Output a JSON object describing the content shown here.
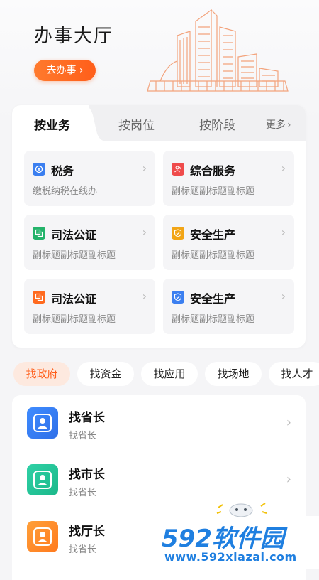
{
  "hero": {
    "title": "办事大厅",
    "button_label": "去办事 ›"
  },
  "tabs": {
    "items": [
      {
        "label": "按业务",
        "active": true
      },
      {
        "label": "按岗位",
        "active": false
      },
      {
        "label": "按阶段",
        "active": false
      }
    ],
    "more_label": "更多",
    "more_chevron": "›"
  },
  "services": [
    {
      "title": "税务",
      "subtitle": "缴税纳税在线办",
      "icon": "tax-icon",
      "color": "#3b7ff0"
    },
    {
      "title": "综合服务",
      "subtitle": "副标题副标题副标题",
      "icon": "people-icon",
      "color": "#ef4b4b"
    },
    {
      "title": "司法公证",
      "subtitle": "副标题副标题副标题",
      "icon": "notary-icon",
      "color": "#23b36a"
    },
    {
      "title": "安全生产",
      "subtitle": "副标题副标题副标题",
      "icon": "shield-icon",
      "color": "#f2a516"
    },
    {
      "title": "司法公证",
      "subtitle": "副标题副标题副标题",
      "icon": "notary-icon",
      "color": "#ff6a1f"
    },
    {
      "title": "安全生产",
      "subtitle": "副标题副标题副标题",
      "icon": "shield-icon",
      "color": "#3b7ff0"
    }
  ],
  "chips": [
    {
      "label": "找政府",
      "active": true
    },
    {
      "label": "找资金",
      "active": false
    },
    {
      "label": "找应用",
      "active": false
    },
    {
      "label": "找场地",
      "active": false
    },
    {
      "label": "找人才",
      "active": false
    }
  ],
  "contacts": [
    {
      "title": "找省长",
      "subtitle": "找省长",
      "icon": "person-icon",
      "color_from": "#3f8cff",
      "color_to": "#2f6fe8"
    },
    {
      "title": "找市长",
      "subtitle": "找省长",
      "icon": "person-icon",
      "color_from": "#2fd1a6",
      "color_to": "#1bb88a"
    },
    {
      "title": "找厅长",
      "subtitle": "找省长",
      "icon": "person-icon",
      "color_from": "#ffa03a",
      "color_to": "#ff7a1e"
    }
  ],
  "chevron": "›",
  "watermark": {
    "number": "592",
    "text": "软件园",
    "url": "www.592xiazai.com"
  }
}
